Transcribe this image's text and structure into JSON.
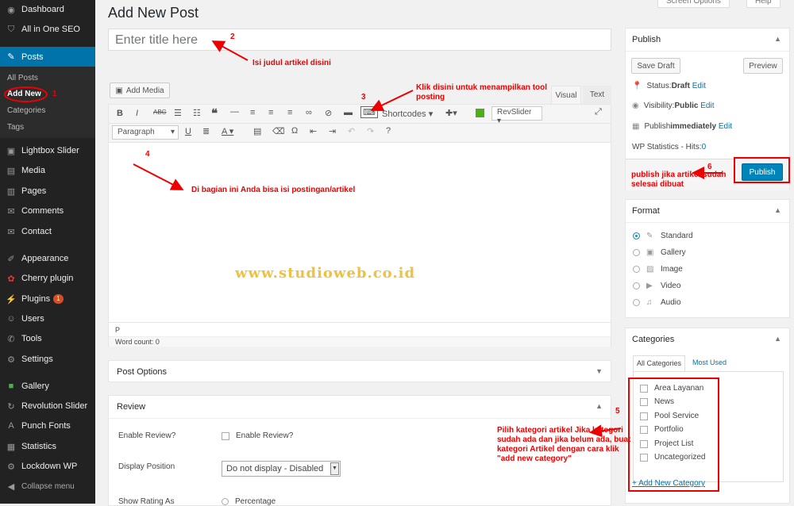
{
  "sidebar": {
    "items": [
      {
        "label": "Dashboard",
        "icon": "dashboard-icon",
        "glyph": "◉"
      },
      {
        "label": "All in One SEO",
        "icon": "shield-icon",
        "glyph": "⛉"
      },
      {
        "label": "Posts",
        "icon": "pin-icon",
        "glyph": "✎"
      },
      {
        "label": "Lightbox Slider",
        "icon": "slider-icon",
        "glyph": "▣"
      },
      {
        "label": "Media",
        "icon": "media-icon",
        "glyph": "▤"
      },
      {
        "label": "Pages",
        "icon": "pages-icon",
        "glyph": "▥"
      },
      {
        "label": "Comments",
        "icon": "comment-icon",
        "glyph": "✉"
      },
      {
        "label": "Contact",
        "icon": "mail-icon",
        "glyph": "✉"
      },
      {
        "label": "Appearance",
        "icon": "brush-icon",
        "glyph": "✐"
      },
      {
        "label": "Cherry plugin",
        "icon": "cherry-icon",
        "glyph": "✿"
      },
      {
        "label": "Plugins",
        "icon": "plugin-icon",
        "glyph": "⚡",
        "badge": "1"
      },
      {
        "label": "Users",
        "icon": "users-icon",
        "glyph": "☺"
      },
      {
        "label": "Tools",
        "icon": "wrench-icon",
        "glyph": "✆"
      },
      {
        "label": "Settings",
        "icon": "settings-icon",
        "glyph": "⚙"
      },
      {
        "label": "Gallery",
        "icon": "gallery-icon",
        "glyph": "■"
      },
      {
        "label": "Revolution Slider",
        "icon": "refresh-icon",
        "glyph": "↻"
      },
      {
        "label": "Punch Fonts",
        "icon": "font-icon",
        "glyph": "A"
      },
      {
        "label": "Statistics",
        "icon": "stats-icon",
        "glyph": "▦"
      },
      {
        "label": "Lockdown WP",
        "icon": "lock-icon",
        "glyph": "⚙"
      }
    ],
    "posts_sub": [
      "All Posts",
      "Add New",
      "Categories",
      "Tags"
    ],
    "collapse": "Collapse menu"
  },
  "page": {
    "title": "Add New Post",
    "screen_options": "Screen Options",
    "help": "Help",
    "title_placeholder": "Enter title here"
  },
  "editor": {
    "add_media": "Add Media",
    "tab_visual": "Visual",
    "tab_text": "Text",
    "shortcodes": "Shortcodes",
    "revslider": "RevSlider",
    "paragraph": "Paragraph",
    "path": "P",
    "word_count": "Word count: 0"
  },
  "post_options": {
    "title": "Post Options"
  },
  "review": {
    "title": "Review",
    "enable_label": "Enable Review?",
    "enable_checkbox": "Enable Review?",
    "display_label": "Display Position",
    "display_value": "Do not display - Disabled",
    "show_label": "Show Rating As",
    "show_value": "Percentage"
  },
  "publish": {
    "title": "Publish",
    "save_draft": "Save Draft",
    "preview": "Preview",
    "status": "Status: ",
    "status_val": "Draft",
    "visibility": "Visibility: ",
    "visibility_val": "Public",
    "schedule": "Publish ",
    "schedule_val": "immediately",
    "edit": "Edit",
    "stats": "WP Statistics - Hits: ",
    "hits": "0",
    "publish_btn": "Publish"
  },
  "format": {
    "title": "Format",
    "options": [
      "Standard",
      "Gallery",
      "Image",
      "Video",
      "Audio"
    ]
  },
  "categories": {
    "title": "Categories",
    "tab_all": "All Categories",
    "tab_most": "Most Used",
    "items": [
      "Area Layanan",
      "News",
      "Pool Service",
      "Portfolio",
      "Project List",
      "Uncategorized"
    ],
    "add_new": "+ Add New Category"
  },
  "annotations": {
    "n1": "1",
    "n2": "2",
    "t2": "Isi judul artikel disini",
    "n3": "3",
    "t3": "Klik disini untuk menampilkan tool posting",
    "n4": "4",
    "t4": "Di bagian ini Anda bisa isi postingan/artikel",
    "n5": "5",
    "t5": "Pilih kategori artikel Jika kategori sudah ada dan jika belum ada, buat kategori Artikel dengan cara klik \"add new category\"",
    "n6": "6",
    "t6": "publish jika artikel sudah selesai dibuat"
  },
  "watermark": "www.studioweb.co.id",
  "colors": {
    "sidebar": "#222222",
    "active": "#0073aa",
    "annotation": "#ee0000",
    "publish": "#0085ba"
  }
}
